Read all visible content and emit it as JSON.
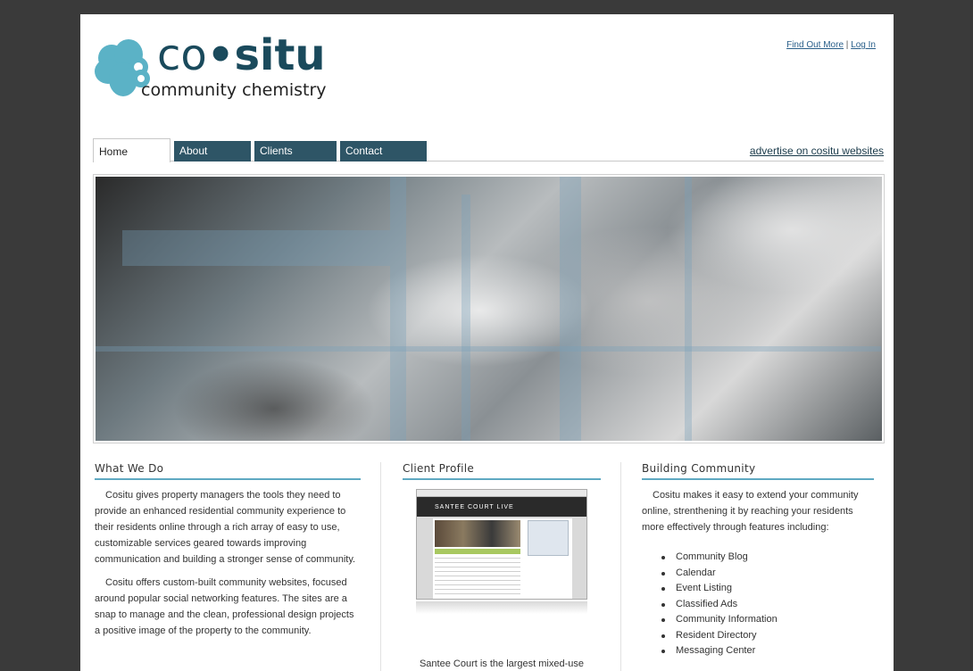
{
  "logo": {
    "word_co": "co",
    "word_dot": "•",
    "word_situ": "situ",
    "tagline": "community chemistry",
    "brand_color": "#5bb2c6"
  },
  "toplinks": {
    "find_out_more": "Find Out More",
    "separator": "|",
    "log_in": "Log In"
  },
  "nav": {
    "tabs": [
      {
        "label": "Home"
      },
      {
        "label": "About"
      },
      {
        "label": "Clients"
      },
      {
        "label": "Contact"
      }
    ],
    "advertise_link": "advertise on cositu websites",
    "tab_color": "#2e5566"
  },
  "what_we_do": {
    "heading": "What We Do",
    "paragraph_1": "Cositu gives property managers the tools they need to provide an enhanced residential community experience to their residents online through a rich array of easy to use, customizable services geared towards improving communication and building a stronger sense of community.",
    "paragraph_2": "Cositu offers custom-built community websites, focused around popular social networking features. The sites are a snap to manage and the clean, professional design projects a positive image of the property to the community."
  },
  "client_profile": {
    "heading": "Client Profile",
    "thumbnail_banner": "SANTEE COURT LIVE",
    "caption": "Santee Court is the largest mixed-use"
  },
  "building_community": {
    "heading": "Building Community",
    "intro": "Cositu makes it easy to extend your community online, strenthening it by reaching your residents more effectively through features including:",
    "features": [
      "Community Blog",
      "Calendar",
      "Event Listing",
      "Classified Ads",
      "Community Information",
      "Resident Directory",
      "Messaging Center"
    ]
  },
  "accent_color": "#5fa9c2"
}
